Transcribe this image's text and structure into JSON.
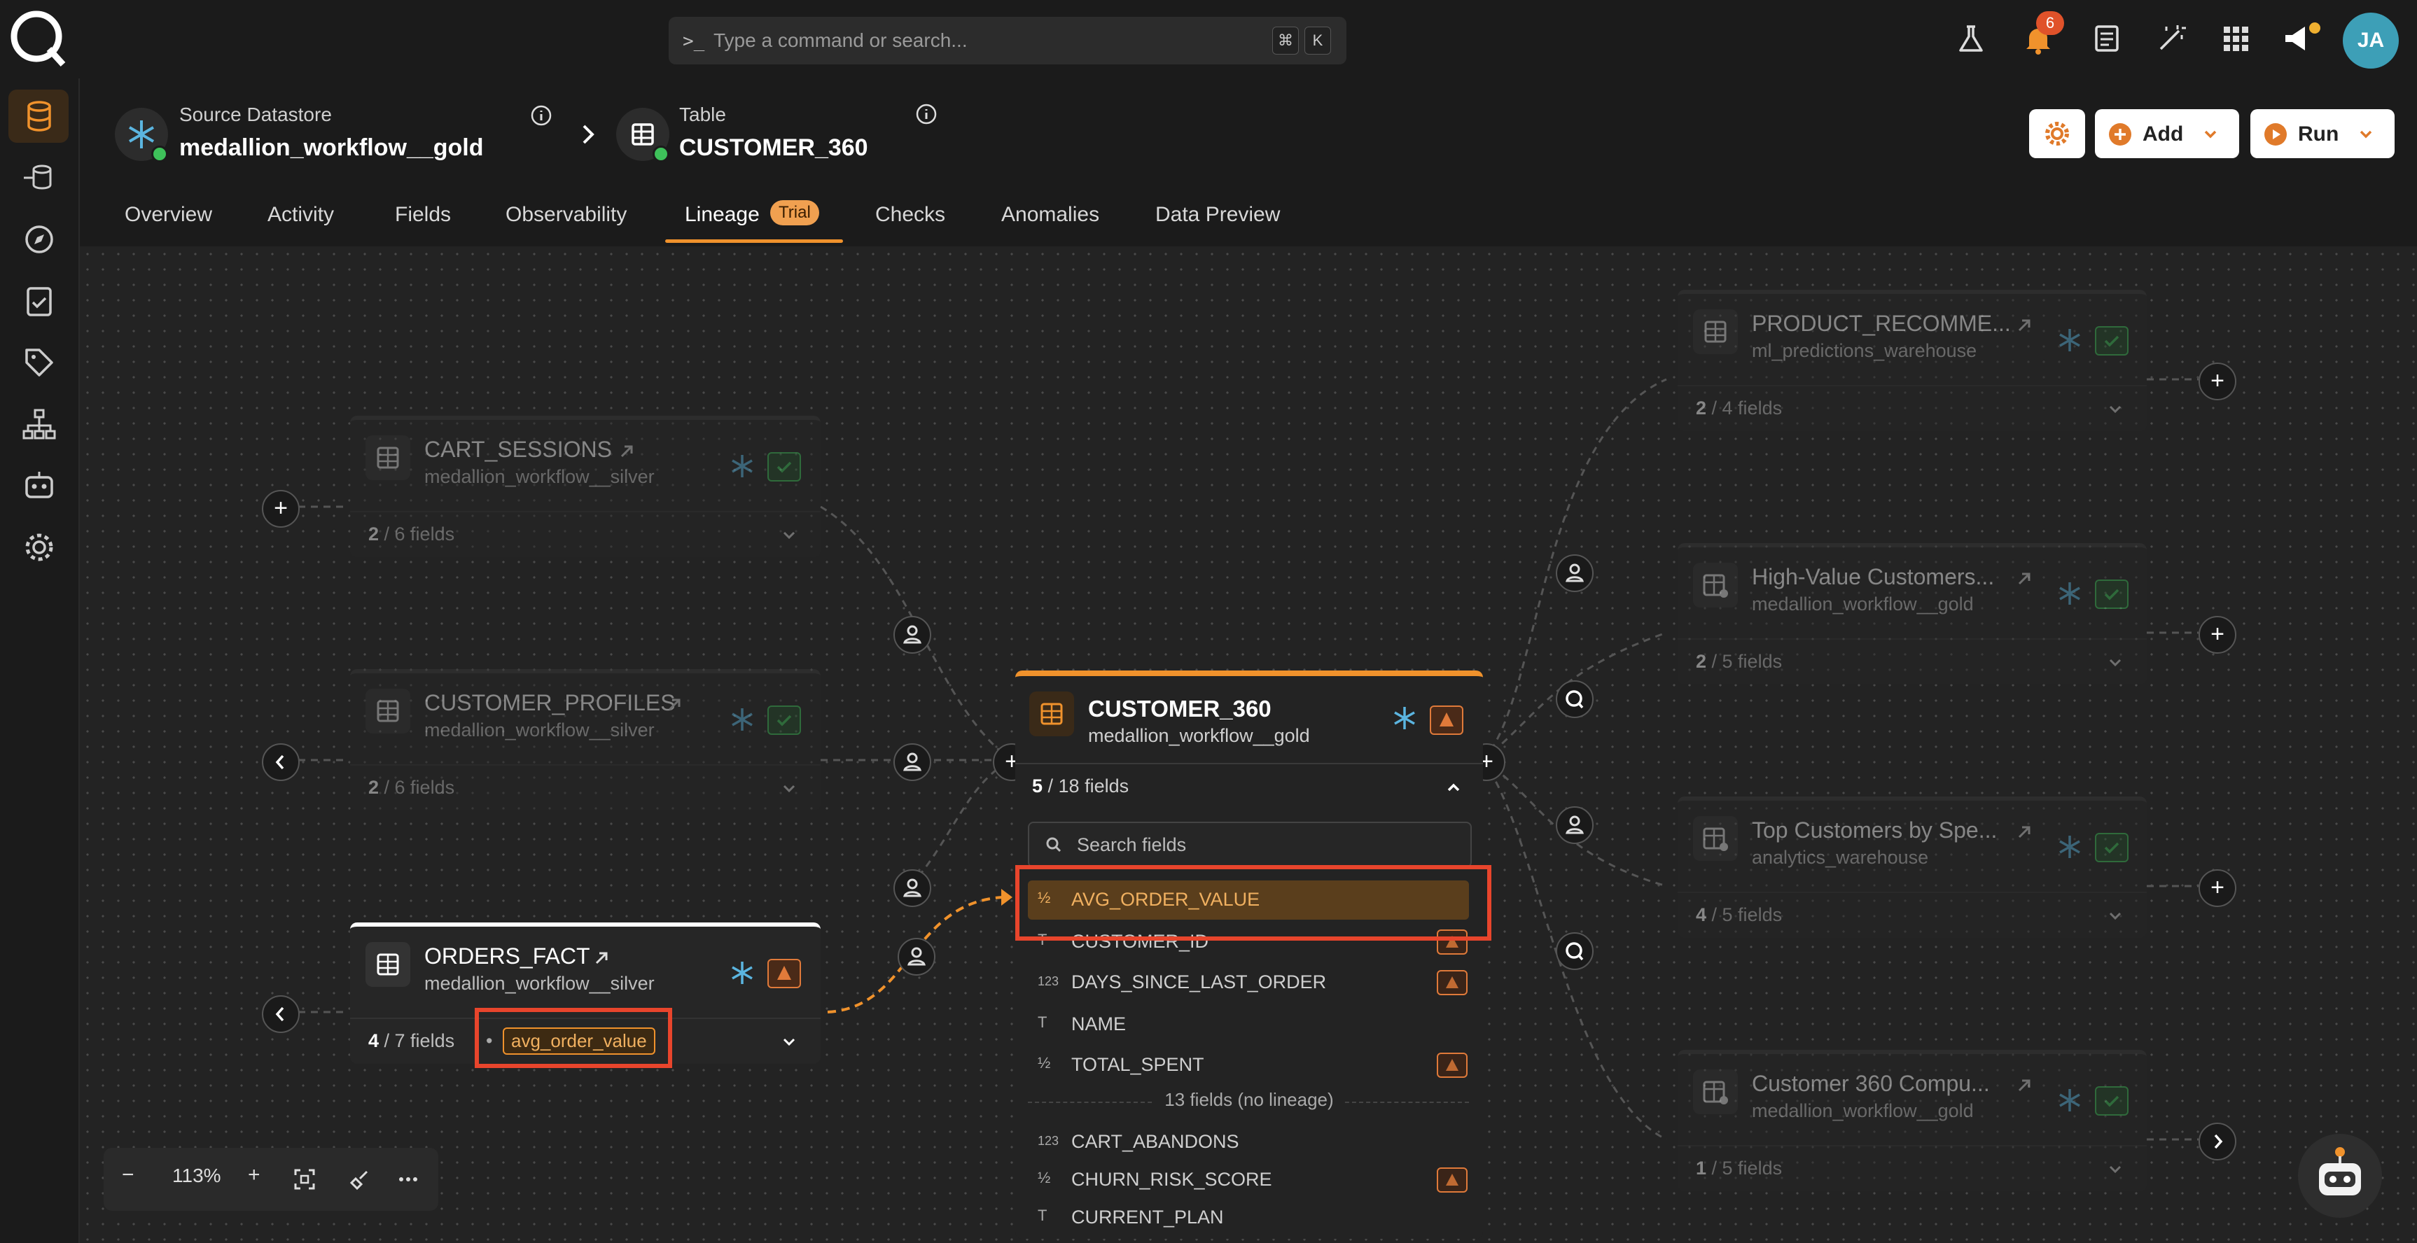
{
  "search": {
    "placeholder": "Type a command or search...",
    "kbd1": "⌘",
    "kbd2": "K"
  },
  "topbar": {
    "notifications_count": "6",
    "avatar_initials": "JA"
  },
  "header": {
    "datastore_label": "Source Datastore",
    "datastore_name": "medallion_workflow__gold",
    "table_label": "Table",
    "table_name": "CUSTOMER_360",
    "settings_label": "",
    "add_label": "Add",
    "run_label": "Run"
  },
  "tabs": [
    {
      "label": "Overview"
    },
    {
      "label": "Activity"
    },
    {
      "label": "Fields"
    },
    {
      "label": "Observability"
    },
    {
      "label": "Lineage"
    },
    {
      "label": "Checks"
    },
    {
      "label": "Anomalies"
    },
    {
      "label": "Data Preview"
    }
  ],
  "trial_badge": "Trial",
  "upstream": [
    {
      "title": "CART_SESSIONS",
      "sub": "medallion_workflow__silver",
      "count": "2",
      "total": " / 6 fields"
    },
    {
      "title": "CUSTOMER_PROFILES",
      "sub": "medallion_workflow__silver",
      "count": "2",
      "total": " / 6 fields"
    },
    {
      "title": "ORDERS_FACT",
      "sub": "medallion_workflow__silver",
      "count": "4",
      "total": " / 7 fields",
      "chip": "avg_order_value"
    }
  ],
  "main_node": {
    "title": "CUSTOMER_360",
    "sub": "medallion_workflow__gold",
    "count": "5",
    "total": " / 18 fields",
    "search_placeholder": "Search fields",
    "fields": [
      {
        "type": "½",
        "name": "AVG_ORDER_VALUE"
      },
      {
        "type": "T",
        "name": "CUSTOMER_ID"
      },
      {
        "type": "123",
        "name": "DAYS_SINCE_LAST_ORDER"
      },
      {
        "type": "T",
        "name": "NAME"
      },
      {
        "type": "½",
        "name": "TOTAL_SPENT"
      }
    ],
    "no_lineage_label": "13 fields (no lineage)",
    "other_fields": [
      {
        "type": "123",
        "name": "CART_ABANDONS"
      },
      {
        "type": "½",
        "name": "CHURN_RISK_SCORE"
      },
      {
        "type": "T",
        "name": "CURRENT_PLAN"
      }
    ]
  },
  "downstream": [
    {
      "title": "PRODUCT_RECOMME...",
      "sub": "ml_predictions_warehouse",
      "count": "2",
      "total": " / 4 fields"
    },
    {
      "title": "High-Value Customers...",
      "sub": "medallion_workflow__gold",
      "count": "2",
      "total": " / 5 fields"
    },
    {
      "title": "Top Customers by Spe...",
      "sub": "analytics_warehouse",
      "count": "4",
      "total": " / 5 fields"
    },
    {
      "title": "Customer 360 Compu...",
      "sub": "medallion_workflow__gold",
      "count": "1",
      "total": " / 5 fields"
    }
  ],
  "zoom": {
    "level": "113%",
    "minus": "−",
    "plus": "+"
  },
  "colors": {
    "accent": "#f0922c",
    "highlight": "#e8452c",
    "ok": "#3ec15a",
    "snowflake": "#5bb5e0"
  }
}
